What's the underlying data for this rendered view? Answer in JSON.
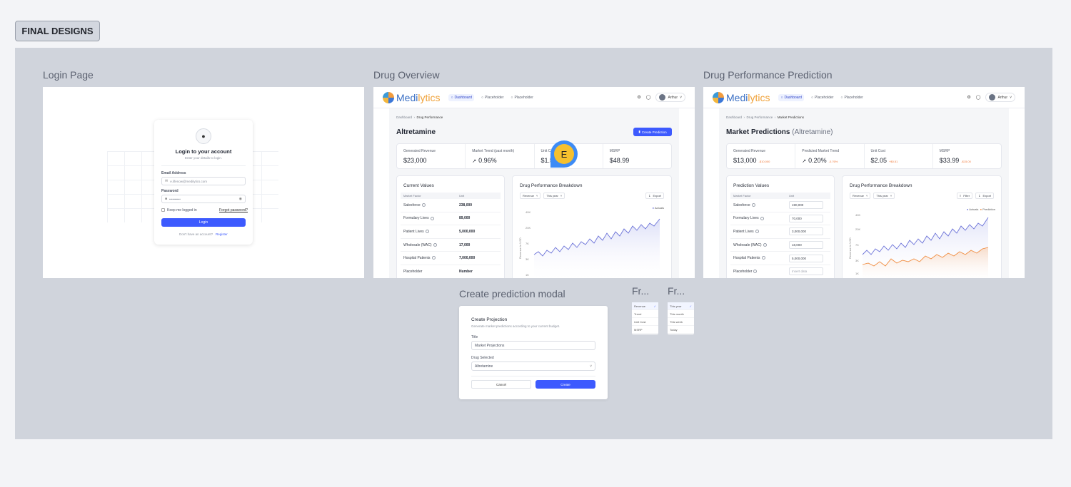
{
  "section_tag": "FINAL DESIGNS",
  "frames": {
    "login_label": "Login Page",
    "overview_label": "Drug Overview",
    "prediction_label": "Drug Performance Prediction",
    "modal_label": "Create prediction modal",
    "fr1_label": "Fr...",
    "fr2_label": "Fr..."
  },
  "login": {
    "title": "Login to your account",
    "subtitle": "Enter your details to login.",
    "email_label": "Email Address",
    "email_placeholder": "e.lifenow@medilytics.com",
    "password_label": "Password",
    "password_value": "••••••••••",
    "remember": "Keep me logged in",
    "forgot": "Forgot password?",
    "login_button": "Login",
    "no_account": "Don't have an account?",
    "register": "Register"
  },
  "app": {
    "logo_a": "Medi",
    "logo_b": "lytics",
    "nav": [
      "Dashboard",
      "Placeholder",
      "Placeholder"
    ],
    "user": "Arthur"
  },
  "overview": {
    "crumbs": [
      "Dashboard",
      "Drug Performance"
    ],
    "title": "Altretamine",
    "create_button": "Create Prediction",
    "stats": [
      {
        "label": "Generated Revenue",
        "value": "$23,000"
      },
      {
        "label": "Market Trend (past month)",
        "value": "0.96%"
      },
      {
        "label": "Unit Cost",
        "value": "$1.5"
      },
      {
        "label": "MSRP",
        "value": "$48.99"
      }
    ],
    "current_values_title": "Current Values",
    "col_factor": "Market Factor",
    "col_unit": "Unit",
    "rows": [
      {
        "factor": "Salesforce",
        "unit": "238,000"
      },
      {
        "factor": "Formulary Lives",
        "unit": "89,000"
      },
      {
        "factor": "Patient Lives",
        "unit": "5,000,000"
      },
      {
        "factor": "Wholesale (WAC)",
        "unit": "17,000"
      },
      {
        "factor": "Hospital Patients",
        "unit": "7,000,000"
      },
      {
        "factor": "Placeholder",
        "unit": "Number"
      }
    ],
    "chart_title": "Drug Performance Breakdown",
    "select_metric": "Revenue",
    "select_period": "This year",
    "export": "Export",
    "legend": "Actuals",
    "y_axis": "Revenue in USD",
    "ticks": [
      "40K",
      "20K",
      "7K",
      "3K",
      "1K"
    ]
  },
  "prediction": {
    "crumbs": [
      "Dashboard",
      "Drug Performance",
      "Market Predictions"
    ],
    "title": "Market Predictions",
    "title_sub": "(Altretamine)",
    "stats": [
      {
        "label": "Generated Revenue",
        "value": "$13,000",
        "delta": "-$10,000"
      },
      {
        "label": "Predicted Market Trend",
        "value": "0.20%",
        "delta": "-0.76%"
      },
      {
        "label": "Unit Cost",
        "value": "$2.05",
        "delta": "+$0.51"
      },
      {
        "label": "MSRP",
        "value": "$33.99",
        "delta": "-$15.00"
      }
    ],
    "values_title": "Prediction Values",
    "col_factor": "Market Factor",
    "col_unit": "Unit",
    "rows": [
      {
        "factor": "Salesforce",
        "unit": "190,000"
      },
      {
        "factor": "Formulary Lives",
        "unit": "70,000"
      },
      {
        "factor": "Patient Lives",
        "unit": "3,000,000"
      },
      {
        "factor": "Wholesale (WAC)",
        "unit": "18,000"
      },
      {
        "factor": "Hospital Patients",
        "unit": "5,000,000"
      },
      {
        "factor": "Placeholder",
        "unit": "Insert data"
      }
    ],
    "chart_title": "Drug Performance Breakdown",
    "select_metric": "Revenue",
    "select_period": "This year",
    "filter": "Filter",
    "export": "Export",
    "legend_a": "Actuals",
    "legend_b": "Prediction",
    "y_axis": "Revenue in USD",
    "ticks": [
      "40K",
      "20K",
      "7K",
      "3K",
      "1K"
    ]
  },
  "modal": {
    "title": "Create Projection",
    "subtitle": "Generate market predictions according to your current budget.",
    "title_label": "Title",
    "title_value": "Market Projections",
    "drug_label": "Drug Selected",
    "drug_value": "Altretamine",
    "cancel": "Cancel",
    "create": "Create"
  },
  "dropdown_metric": [
    "Revenue",
    "Trend",
    "Unit Cost",
    "MSRP"
  ],
  "dropdown_period": [
    "This year",
    "This month",
    "This week",
    "Today"
  ],
  "cursor_badge": "E",
  "colors": {
    "accent": "#3d5afe",
    "prediction": "#f08a3c",
    "actuals": "#6c73d8"
  }
}
